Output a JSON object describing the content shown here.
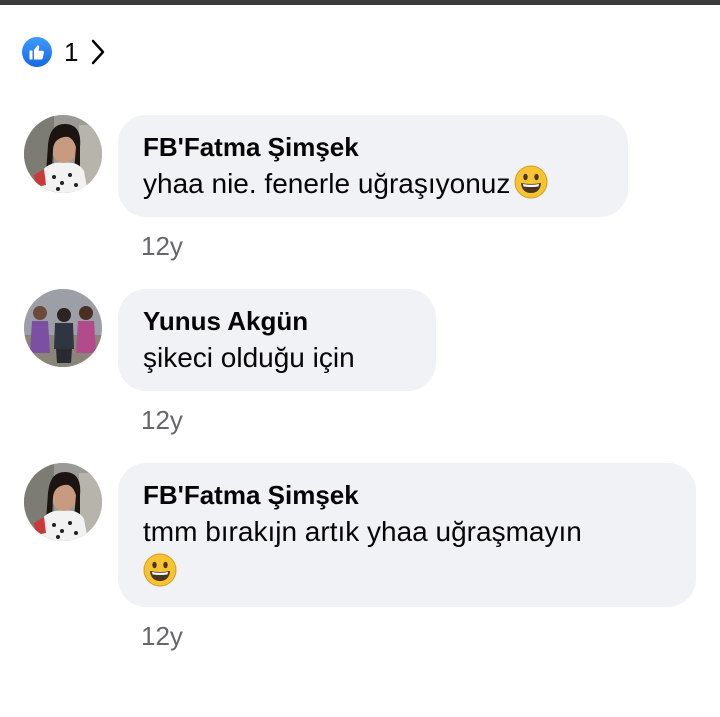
{
  "reactions": {
    "icon": "like-icon",
    "count": "1",
    "accent_color": "#1877f2"
  },
  "comments": [
    {
      "author": "FB'Fatma Şimşek",
      "text": "yhaa nie. fenerle uğraşıyonuz",
      "emoji": "grinning-face-emoji",
      "timestamp": "12y"
    },
    {
      "author": "Yunus Akgün",
      "text": "şikeci olduğu için",
      "timestamp": "12y"
    },
    {
      "author": "FB'Fatma Şimşek",
      "text": "tmm bırakıjn artık yhaa uğraşmayın",
      "emoji": "grinning-face-emoji",
      "timestamp": "12y"
    }
  ]
}
